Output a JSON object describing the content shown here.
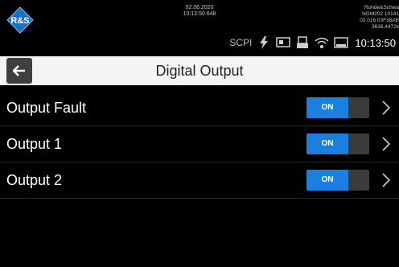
{
  "status": {
    "date": "02.06.2020",
    "time_precise": "10:13:50.648",
    "device_lines": [
      "Rohde&Schwa",
      "NGM202 10141",
      "02.016 03F38AB",
      "3638.4472k"
    ],
    "scpi_label": "SCPI",
    "clock": "10:13:50",
    "icons": [
      "lightning-icon",
      "display-icon",
      "usb-icon",
      "wifi-icon",
      "screen-icon"
    ]
  },
  "titlebar": {
    "title": "Digital Output",
    "back_icon": "arrow-left-icon"
  },
  "outputs": [
    {
      "label": "Output Fault",
      "state": "ON"
    },
    {
      "label": "Output 1",
      "state": "ON"
    },
    {
      "label": "Output 2",
      "state": "ON"
    }
  ],
  "colors": {
    "accent": "#1b7fe0",
    "titlebar_bg": "#f4f4f4",
    "background": "#000000"
  }
}
